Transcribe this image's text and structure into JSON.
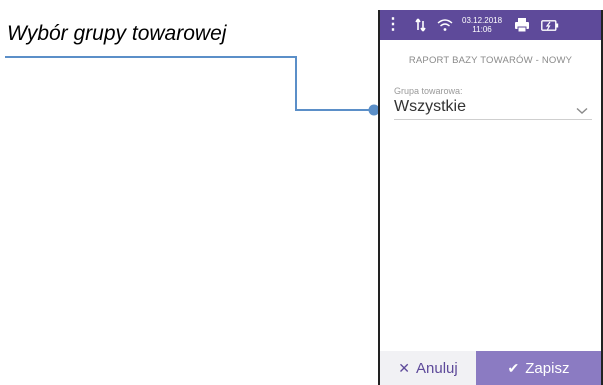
{
  "annotation": {
    "caption": "Wybór grupy towarowej"
  },
  "status_bar": {
    "date": "03.12.2018",
    "time": "11:06",
    "icons": [
      "menu-dots-icon",
      "data-transfer-icon",
      "wifi-icon",
      "printer-icon",
      "battery-icon"
    ]
  },
  "screen": {
    "title": "RAPORT BAZY TOWARÓW - NOWY",
    "group_field": {
      "label": "Grupa towarowa:",
      "value": "Wszystkie"
    }
  },
  "buttons": {
    "cancel_label": "Anuluj",
    "save_label": "Zapisz"
  },
  "colors": {
    "status_bar": "#5e4a9a",
    "accent": "#5e4a9a",
    "save_button": "#8b7bc2",
    "leader_line": "#5b8fc8"
  }
}
